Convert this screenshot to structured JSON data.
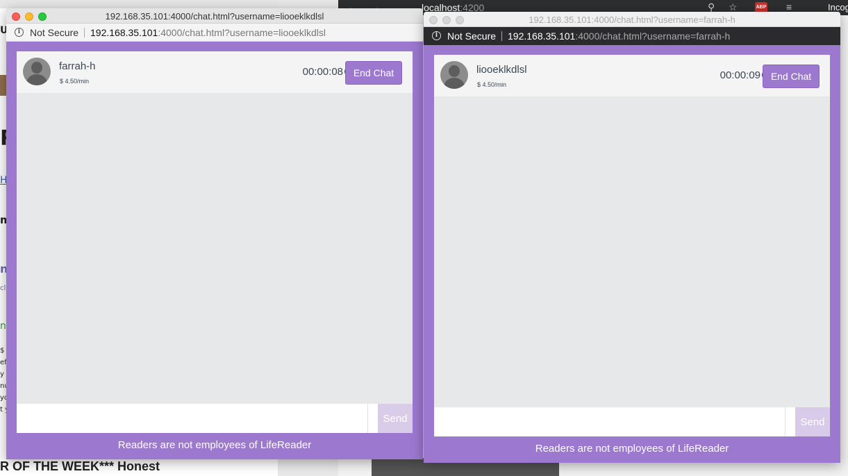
{
  "background": {
    "left_window_fragments": [
      "U",
      "R",
      "H",
      "m",
      "nf",
      "cl",
      "n",
      "$ 4",
      "efi",
      "y a",
      "nu",
      "yo",
      "t y"
    ],
    "left_bottom_banner": "R OF THE WEEK*** Honest",
    "right_browser": {
      "url_host": "localhost",
      "url_port": ":4200",
      "abp_label": "ABP",
      "incognito_label": "Incog"
    }
  },
  "windows": [
    {
      "title": "192.168.35.101:4000/chat.html?username=liooeklkdlsl",
      "security_label": "Not Secure",
      "url_host": "192.168.35.101",
      "url_path": ":4000/chat.html?username=liooeklkdlsl",
      "peer_name": "farrah-h",
      "rate": "$ 4.50/min",
      "timer": "00:00:08",
      "end_chat_label": "End Chat",
      "message_value": "",
      "send_label": "Send",
      "footer": "Readers are not employees of LifeReader"
    },
    {
      "title": "192.168.35.101:4000/chat.html?username=farrah-h",
      "security_label": "Not Secure",
      "url_host": "192.168.35.101",
      "url_path": ":4000/chat.html?username=farrah-h",
      "peer_name": "liooeklkdlsl",
      "rate": "$ 4.50/min",
      "timer": "00:00:09",
      "end_chat_label": "End Chat",
      "message_value": "",
      "send_label": "Send",
      "footer": "Readers are not employees of LifeReader"
    }
  ],
  "colors": {
    "brand_purple": "#9c78cf",
    "send_disabled": "#d9cce9",
    "header_text": "#3a4654"
  }
}
